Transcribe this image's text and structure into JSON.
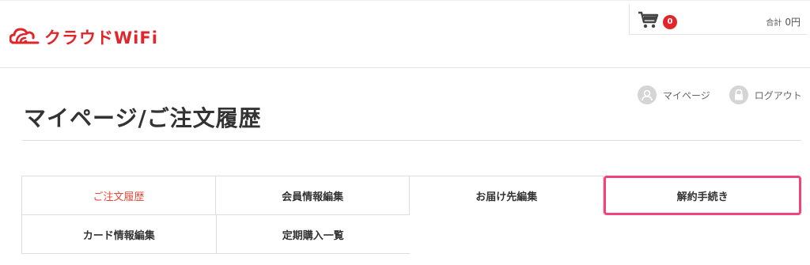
{
  "brand": {
    "name": "クラウドWiFi",
    "color": "#e0262b"
  },
  "cart": {
    "count": "0",
    "total_label": "合計",
    "total_value": "0円"
  },
  "user_links": [
    {
      "label": "マイページ",
      "icon": "user-icon"
    },
    {
      "label": "ログアウト",
      "icon": "lock-icon"
    }
  ],
  "page": {
    "title": "マイページ/ご注文履歴"
  },
  "menu": {
    "row1": [
      "ご注文履歴",
      "会員情報編集",
      "お届け先編集",
      "解約手続き"
    ],
    "row2": [
      "カード情報編集",
      "定期購入一覧"
    ]
  },
  "colors": {
    "active": "#e04a3a",
    "highlight": "#f0457a"
  }
}
